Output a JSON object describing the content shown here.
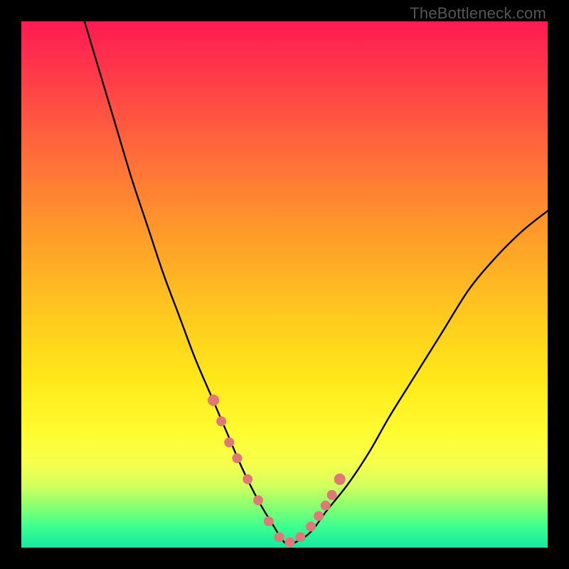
{
  "watermark": "TheBottleneck.com",
  "colors": {
    "frame": "#000000",
    "marker": "#e17878",
    "curve": "#000000",
    "gradient_top": "#ff1a52",
    "gradient_bottom": "#14e8a0"
  },
  "chart_data": {
    "type": "line",
    "title": "",
    "xlabel": "",
    "ylabel": "",
    "xlim": [
      0,
      100
    ],
    "ylim": [
      0,
      100
    ],
    "series": [
      {
        "name": "bottleneck-curve",
        "x": [
          12,
          15,
          18,
          21,
          24,
          27,
          30,
          33,
          36,
          39,
          42,
          45,
          48,
          50,
          52,
          55,
          58,
          62,
          66,
          70,
          75,
          80,
          85,
          90,
          95,
          100
        ],
        "y": [
          100,
          90,
          80,
          70,
          61,
          52,
          44,
          36,
          29,
          22,
          15,
          9,
          4,
          1,
          1,
          3,
          7,
          12,
          18,
          25,
          33,
          41,
          49,
          55,
          60,
          64
        ]
      }
    ],
    "markers": {
      "name": "highlighted-points",
      "x": [
        36.5,
        38,
        39.5,
        41,
        43,
        45,
        47,
        49,
        51,
        53,
        55,
        56.5,
        57.8,
        59,
        60.5
      ],
      "y": [
        28,
        24,
        20,
        17,
        13,
        9,
        5,
        2,
        1,
        2,
        4,
        6,
        8,
        10,
        13
      ]
    }
  }
}
